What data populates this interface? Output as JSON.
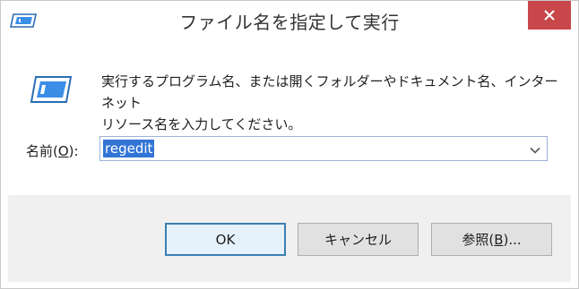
{
  "window": {
    "title": "ファイル名を指定して実行",
    "close_glyph": "close-icon",
    "app_icon": "run-icon"
  },
  "main": {
    "description_line1": "実行するプログラム名、または開くフォルダーやドキュメント名、インターネット",
    "description_line2": "リソース名を入力してください。",
    "open_label_prefix": "名前(",
    "open_label_mnemonic": "O",
    "open_label_suffix": "):",
    "input_value": "regedit",
    "dropdown_icon": "chevron-down-icon"
  },
  "buttons": {
    "ok_label": "OK",
    "cancel_label": "キャンセル",
    "browse_prefix": "参照(",
    "browse_mnemonic": "B",
    "browse_suffix": ")..."
  },
  "colors": {
    "close_button": "#c7474a",
    "selection": "#3375d6",
    "button_bar": "#f0f0f0",
    "default_button_border": "#3c7fb1"
  }
}
